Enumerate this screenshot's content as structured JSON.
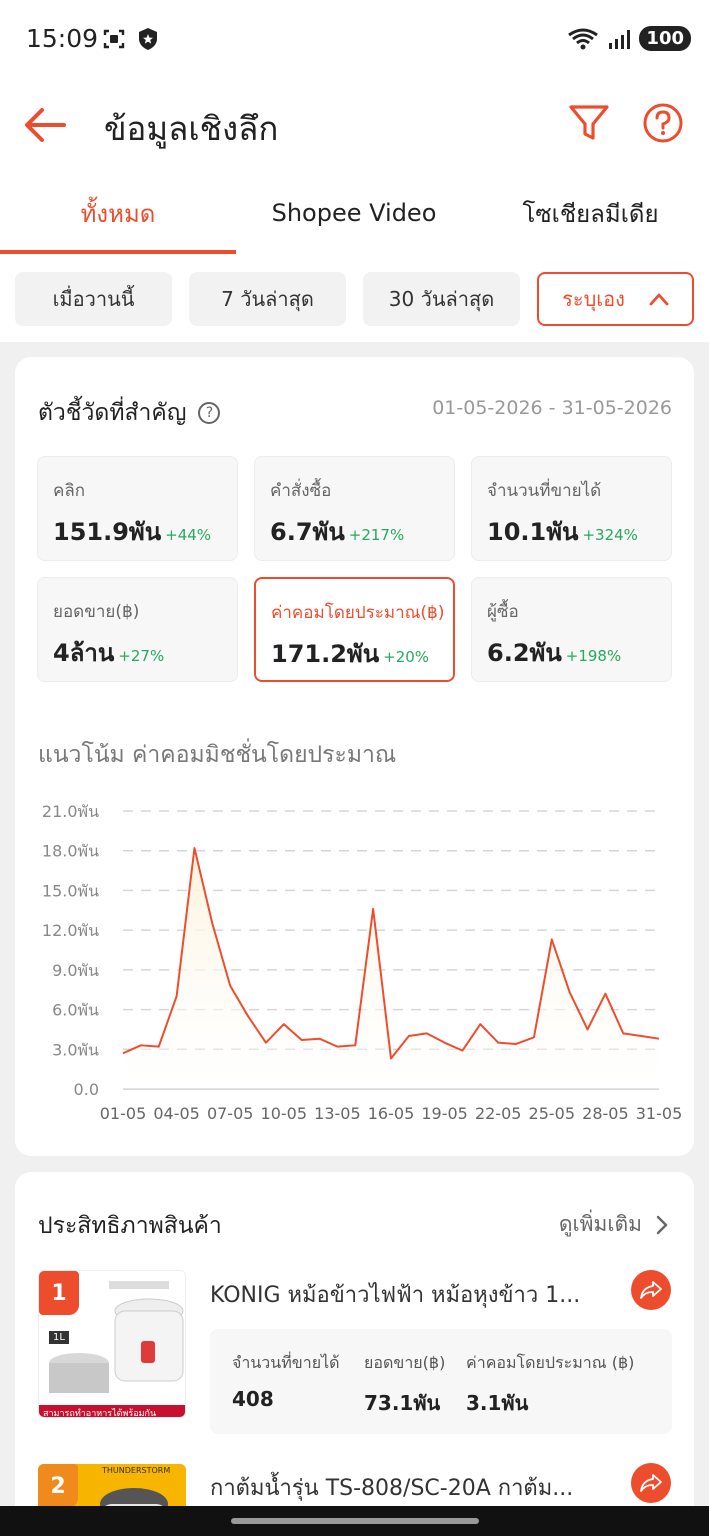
{
  "status": {
    "time": "15:09",
    "battery": "100"
  },
  "header": {
    "title": "ข้อมูลเชิงลึก",
    "icons": [
      "back-arrow-icon",
      "filter-icon",
      "help-icon"
    ]
  },
  "tabs": [
    {
      "label": "ทั้งหมด",
      "active": true
    },
    {
      "label": "Shopee Video",
      "active": false
    },
    {
      "label": "โซเชียลมีเดีย",
      "active": false
    }
  ],
  "ranges": [
    {
      "label": "เมื่อวานนี้"
    },
    {
      "label": "7 วันล่าสุด"
    },
    {
      "label": "30 วันล่าสุด"
    },
    {
      "label": "ระบุเอง",
      "active": true
    }
  ],
  "metrics": {
    "title": "ตัวชี้วัดที่สำคัญ",
    "date_range": "01-05-2026 - 31-05-2026",
    "items": [
      {
        "label": "คลิก",
        "value": "151.9พัน",
        "change": "+44%"
      },
      {
        "label": "คำสั่งซื้อ",
        "value": "6.7พัน",
        "change": "+217%"
      },
      {
        "label": "จำนวนที่ขายได้",
        "value": "10.1พัน",
        "change": "+324%"
      },
      {
        "label": "ยอดขาย(฿)",
        "value": "4ล้าน",
        "change": "+27%"
      },
      {
        "label": "ค่าคอมโดยประมาณ(฿)",
        "value": "171.2พัน",
        "change": "+20%",
        "active": true
      },
      {
        "label": "ผู้ซื้อ",
        "value": "6.2พัน",
        "change": "+198%"
      }
    ]
  },
  "chart_data": {
    "type": "area",
    "title": "แนวโน้ม ค่าคอมมิชชั่นโดยประมาณ",
    "x": [
      "01-05",
      "02-05",
      "03-05",
      "04-05",
      "05-05",
      "06-05",
      "07-05",
      "08-05",
      "09-05",
      "10-05",
      "11-05",
      "12-05",
      "13-05",
      "14-05",
      "15-05",
      "16-05",
      "17-05",
      "18-05",
      "19-05",
      "20-05",
      "21-05",
      "22-05",
      "23-05",
      "24-05",
      "25-05",
      "26-05",
      "27-05",
      "28-05",
      "29-05",
      "30-05",
      "31-05"
    ],
    "x_tick_labels": [
      "01-05",
      "04-05",
      "07-05",
      "10-05",
      "13-05",
      "16-05",
      "19-05",
      "22-05",
      "25-05",
      "28-05",
      "31-05"
    ],
    "values": [
      2.7,
      3.3,
      3.2,
      7.0,
      18.2,
      12.5,
      7.8,
      5.5,
      3.5,
      4.9,
      3.7,
      3.8,
      3.2,
      3.3,
      13.6,
      2.3,
      4.0,
      4.2,
      3.5,
      2.9,
      4.9,
      3.5,
      3.4,
      3.9,
      11.3,
      7.3,
      4.5,
      7.2,
      4.2,
      4.0,
      3.8
    ],
    "y_ticks": [
      "0.0",
      "3.0พัน",
      "6.0พัน",
      "9.0พัน",
      "12.0พัน",
      "15.0พัน",
      "18.0พัน",
      "21.0พัน"
    ],
    "ylim": [
      0,
      21
    ],
    "grid": true,
    "line_color": "#ee4d2d",
    "fill_color": "#fdf3dc"
  },
  "performance": {
    "title": "ประสิทธิภาพสินค้า",
    "more_label": "ดูเพิ่มเติม",
    "products": [
      {
        "rank": "1",
        "name": "KONIG หม้อข้าวไฟฟ้า หม้อหุงข้าว 1...",
        "image_caption": "สามารถทำอาหารได้พร้อมกัน",
        "image_tag": "1L",
        "stats": [
          {
            "label": "จำนวนที่ขายได้",
            "value": "408"
          },
          {
            "label": "ยอดขาย(฿)",
            "value": "73.1พัน"
          },
          {
            "label": "ค่าคอมโดยประมาณ (฿)",
            "value": "3.1พัน"
          }
        ]
      },
      {
        "rank": "2",
        "name": "กาต้มน้ำรุ่น TS-808/SC-20A กาต้ม...",
        "image_brand": "THUNDERSTORM"
      }
    ]
  },
  "colors": {
    "accent": "#ee4d2d",
    "positive": "#26aa5e"
  }
}
